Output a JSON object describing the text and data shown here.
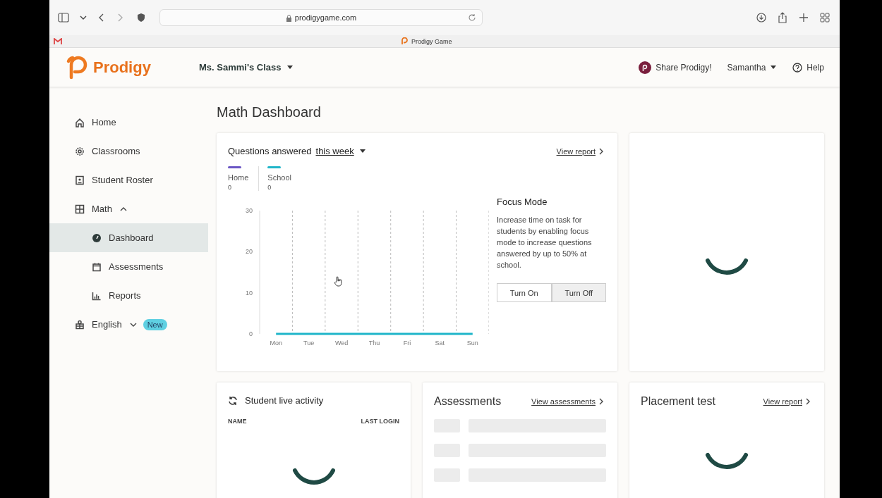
{
  "browser": {
    "url": "prodigygame.com",
    "tab_title": "Prodigy Game"
  },
  "header": {
    "logo": "Prodigy",
    "class_selector": "Ms. Sammi's Class",
    "share": "Share Prodigy!",
    "user": "Samantha",
    "help": "Help"
  },
  "sidebar": {
    "items": [
      {
        "label": "Home",
        "selected": false
      },
      {
        "label": "Classrooms",
        "selected": false
      },
      {
        "label": "Student Roster",
        "selected": false
      },
      {
        "label": "Math",
        "selected": false,
        "expanded": true,
        "children": [
          {
            "label": "Dashboard",
            "selected": true
          },
          {
            "label": "Assessments",
            "selected": false
          },
          {
            "label": "Reports",
            "selected": false
          }
        ]
      },
      {
        "label": "English",
        "selected": false,
        "expanded": false,
        "badge": "New"
      }
    ]
  },
  "page_title": "Math Dashboard",
  "questions_card": {
    "title": "Questions answered",
    "period": "this week",
    "link": "View report",
    "legend_values": [
      "0",
      "0"
    ],
    "chart_data": {
      "type": "line",
      "categories": [
        "Mon",
        "Tue",
        "Wed",
        "Thu",
        "Fri",
        "Sat",
        "Sun"
      ],
      "ylim": [
        0,
        30
      ],
      "yticks": [
        0,
        10,
        20,
        30
      ],
      "series": [
        {
          "name": "Home",
          "color": "#6a55c4",
          "values": [
            null,
            null,
            null,
            null,
            null,
            null,
            null
          ]
        },
        {
          "name": "School",
          "color": "#1fb5c9",
          "values": [
            0,
            0,
            0,
            0,
            0,
            0,
            0
          ]
        }
      ]
    },
    "focus_mode": {
      "title": "Focus Mode",
      "text": "Increase time on task for students by enabling focus mode to increase questions answered by up to 50% at school.",
      "options": [
        {
          "label": "Turn On",
          "selected": false
        },
        {
          "label": "Turn Off",
          "selected": true
        }
      ]
    }
  },
  "live_activity": {
    "title": "Student live activity",
    "columns": [
      "NAME",
      "LAST LOGIN"
    ]
  },
  "assessments": {
    "title": "Assessments",
    "link": "View assessments"
  },
  "placement_test": {
    "title": "Placement test",
    "link": "View report"
  }
}
